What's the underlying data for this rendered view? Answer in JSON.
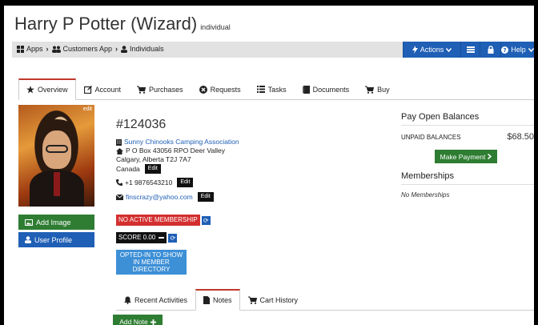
{
  "header": {
    "title": "Harry P Potter (Wizard)",
    "subtitle": "individual"
  },
  "breadcrumb": [
    {
      "label": "Apps",
      "icon": "grid-icon"
    },
    {
      "label": "Customers App",
      "icon": "users-icon"
    },
    {
      "label": "Individuals",
      "icon": "user-icon"
    }
  ],
  "nav": {
    "actions_label": "Actions",
    "help_label": "Help"
  },
  "tabs": [
    {
      "label": "Overview",
      "icon": "star-icon",
      "active": true
    },
    {
      "label": "Account",
      "icon": "edit-icon",
      "active": false
    },
    {
      "label": "Purchases",
      "icon": "cart-icon",
      "active": false
    },
    {
      "label": "Requests",
      "icon": "circle-x-icon",
      "active": false
    },
    {
      "label": "Tasks",
      "icon": "list-icon",
      "active": false
    },
    {
      "label": "Documents",
      "icon": "book-icon",
      "active": false
    },
    {
      "label": "Buy",
      "icon": "cart-icon",
      "active": false
    }
  ],
  "profile": {
    "edit_label": "edit",
    "add_image_label": "Add Image",
    "user_profile_label": "User Profile"
  },
  "details": {
    "member_id": "#124036",
    "organization": "Sunny Chinooks Camping Association",
    "address_line1": "P O Box 43056 RPO Deer Valley",
    "address_line2": "Calgary, Alberta T2J 7A7",
    "country": "Canada",
    "phone": "+1 9876543210",
    "email": "finscrazy@yahoo.com",
    "edit_label": "Edit",
    "membership_status": "NO ACTIVE MEMBERSHIP",
    "score_label": "SCORE 0.00",
    "opted_in": "OPTED-IN TO SHOW IN MEMBER DIRECTORY"
  },
  "balances": {
    "heading": "Pay Open Balances",
    "unpaid_label": "UNPAID BALANCES",
    "unpaid_value": "$68.50",
    "make_payment_label": "Make Payment"
  },
  "memberships": {
    "heading": "Memberships",
    "empty_text": "No Memberships"
  },
  "sub_tabs": [
    {
      "label": "Recent Activities",
      "icon": "bell-icon",
      "active": false
    },
    {
      "label": "Notes",
      "icon": "file-icon",
      "active": true
    },
    {
      "label": "Cart History",
      "icon": "cart-icon",
      "active": false
    }
  ],
  "notes": {
    "add_note_label": "Add Note"
  },
  "colors": {
    "primary_blue": "#1f5fb5",
    "success_green": "#2e7d32",
    "danger_red": "#d32f2f",
    "active_tab_accent": "#c0392b"
  }
}
